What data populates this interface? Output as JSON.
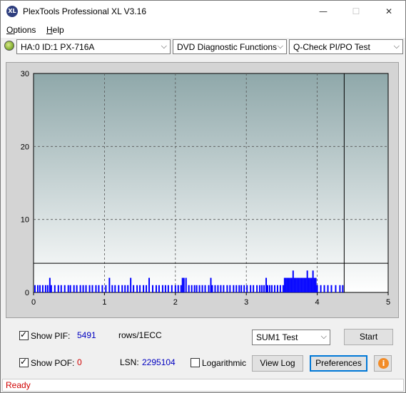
{
  "window": {
    "title": "PlexTools Professional XL V3.16",
    "icon_text": "XL",
    "min_glyph": "—",
    "max_glyph": "☐",
    "close_glyph": "✕"
  },
  "menu": [
    {
      "label": "Options",
      "hotkey": "O",
      "rest": "ptions"
    },
    {
      "label": "Help",
      "hotkey": "H",
      "rest": "elp"
    }
  ],
  "toolbar": {
    "drive": "HA:0 ID:1  PX-716A",
    "function": "DVD Diagnostic Functions",
    "test": "Q-Check PI/PO Test",
    "arrow": "⌵"
  },
  "chart_data": {
    "type": "bar",
    "x_range": [
      0,
      5
    ],
    "y_range": [
      0,
      30
    ],
    "x_ticks": [
      "0",
      "1",
      "2",
      "3",
      "4",
      "5"
    ],
    "y_ticks": [
      "0",
      "10",
      "20",
      "30"
    ],
    "grid": true,
    "vline_x": 4.38,
    "threshold_y": 4,
    "series": [
      {
        "color": "#0000ff",
        "x": [
          0.02,
          0.06,
          0.09,
          0.13,
          0.17,
          0.2,
          0.23,
          0.25,
          0.3,
          0.35,
          0.39,
          0.44,
          0.49,
          0.52,
          0.57,
          0.61,
          0.66,
          0.7,
          0.74,
          0.79,
          0.83,
          0.88,
          0.92,
          0.97,
          1.02,
          1.07,
          1.11,
          1.15,
          1.2,
          1.25,
          1.29,
          1.33,
          1.37,
          1.41,
          1.46,
          1.5,
          1.55,
          1.59,
          1.63,
          1.68,
          1.73,
          1.77,
          1.82,
          1.86,
          1.9,
          1.95,
          2.0,
          2.04,
          2.08,
          2.1,
          2.12,
          2.15,
          2.19,
          2.23,
          2.27,
          2.3,
          2.34,
          2.38,
          2.42,
          2.47,
          2.5,
          2.52,
          2.56,
          2.6,
          2.64,
          2.68,
          2.73,
          2.77,
          2.82,
          2.86,
          2.9,
          2.93,
          2.97,
          3.01,
          3.06,
          3.1,
          3.15,
          3.19,
          3.22,
          3.25,
          3.28,
          3.3,
          3.33,
          3.36,
          3.4,
          3.44,
          3.48,
          3.52,
          3.54,
          3.56,
          3.58,
          3.6,
          3.62,
          3.64,
          3.66,
          3.68,
          3.7,
          3.72,
          3.74,
          3.76,
          3.78,
          3.8,
          3.82,
          3.84,
          3.86,
          3.88,
          3.9,
          3.92,
          3.94,
          3.96,
          3.98,
          4.0,
          4.05,
          4.1,
          4.15,
          4.2,
          4.26,
          4.32,
          4.36
        ],
        "values": [
          1,
          1,
          1,
          1,
          1,
          1,
          2,
          1,
          1,
          1,
          1,
          1,
          1,
          1,
          1,
          1,
          1,
          1,
          1,
          1,
          1,
          1,
          1,
          1,
          1,
          2,
          1,
          1,
          1,
          1,
          1,
          1,
          2,
          1,
          1,
          1,
          1,
          1,
          2,
          1,
          1,
          1,
          1,
          1,
          1,
          1,
          1,
          1,
          1,
          2,
          2,
          2,
          1,
          1,
          1,
          1,
          1,
          1,
          1,
          1,
          2,
          1,
          1,
          1,
          1,
          1,
          1,
          1,
          1,
          1,
          1,
          1,
          1,
          1,
          1,
          1,
          1,
          1,
          1,
          1,
          2,
          1,
          1,
          1,
          1,
          1,
          1,
          1,
          2,
          2,
          2,
          2,
          2,
          2,
          3,
          2,
          2,
          2,
          2,
          2,
          2,
          2,
          2,
          2,
          3,
          2,
          2,
          2,
          3,
          2,
          2,
          1,
          1,
          1,
          1,
          1,
          1,
          1,
          1
        ]
      }
    ]
  },
  "controls": {
    "show_pif_label": "Show PIF:",
    "pif_value": "5491",
    "rows_label": "rows/1ECC",
    "show_pof_label": "Show POF:",
    "pof_value": "0",
    "lsn_label": "LSN:",
    "lsn_value": "2295104",
    "logarithmic_label": "Logarithmic",
    "sum_select": "SUM1 Test",
    "start_button": "Start",
    "view_log_button": "View Log",
    "preferences_button": "Preferences",
    "info_icon": "i",
    "pif_color": "#0000c0",
    "pof_color": "#d00000"
  },
  "status": {
    "text": "Ready",
    "color": "#d00000"
  }
}
